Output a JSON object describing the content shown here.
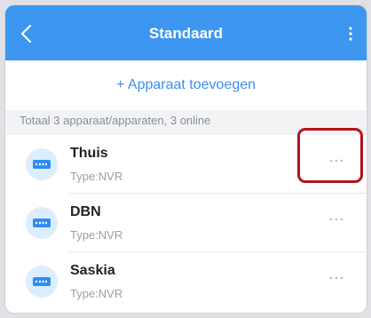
{
  "header": {
    "title": "Standaard"
  },
  "add_device": {
    "label": "+ Apparaat toevoegen"
  },
  "summary": {
    "text": "Totaal 3 apparaat/apparaten, 3 online"
  },
  "devices": [
    {
      "name": "Thuis",
      "type": "Type:NVR",
      "icon": "nvr-recorder-icon"
    },
    {
      "name": "DBN",
      "type": "Type:NVR",
      "icon": "nvr-recorder-icon"
    },
    {
      "name": "Saskia",
      "type": "Type:NVR",
      "icon": "nvr-recorder-icon"
    }
  ],
  "colors": {
    "header_bg": "#3d97f0",
    "accent": "#3d8ff0",
    "highlight": "#b3121a"
  }
}
